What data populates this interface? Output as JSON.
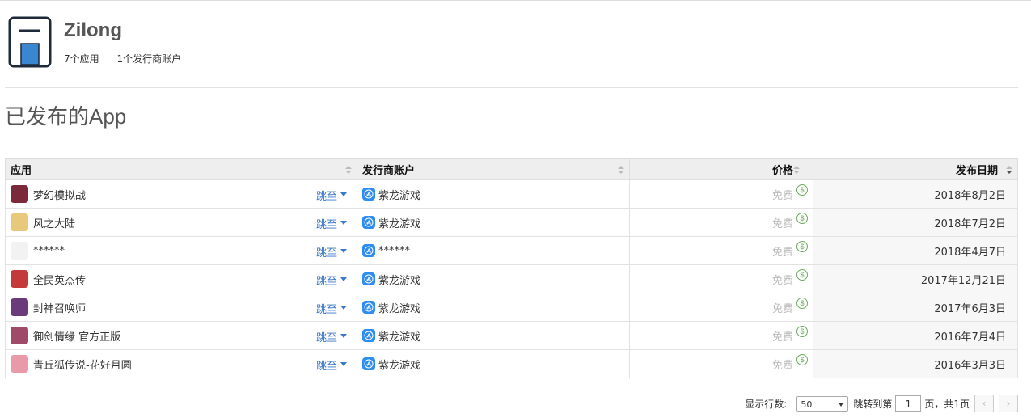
{
  "developer": {
    "name": "Zilong",
    "apps_count": "7个应用",
    "publisher_count": "1个发行商账户"
  },
  "section_title": "已发布的App",
  "table": {
    "headers": {
      "app": "应用",
      "publisher": "发行商账户",
      "price": "价格",
      "release_date": "发布日期"
    },
    "jump_label": "跳至",
    "rows": [
      {
        "app": "梦幻模拟战",
        "publisher": "紫龙游戏",
        "price": "免费",
        "date": "2018年8月2日",
        "icon_color": "#7a2a3a"
      },
      {
        "app": "风之大陆",
        "publisher": "紫龙游戏",
        "price": "免费",
        "date": "2018年7月2日",
        "icon_color": "#e8c87a"
      },
      {
        "app": "******",
        "publisher": "******",
        "price": "免费",
        "date": "2018年4月7日",
        "icon_color": "#f2f2f2"
      },
      {
        "app": "全民英杰传",
        "publisher": "紫龙游戏",
        "price": "免费",
        "date": "2017年12月21日",
        "icon_color": "#c43a3a"
      },
      {
        "app": "封神召唤师",
        "publisher": "紫龙游戏",
        "price": "免费",
        "date": "2017年6月3日",
        "icon_color": "#6a3a7a"
      },
      {
        "app": "御剑情缘 官方正版",
        "publisher": "紫龙游戏",
        "price": "免费",
        "date": "2016年7月4日",
        "icon_color": "#a04a6a"
      },
      {
        "app": "青丘狐传说-花好月圆",
        "publisher": "紫龙游戏",
        "price": "免费",
        "date": "2016年3月3日",
        "icon_color": "#e89aa8"
      }
    ]
  },
  "pagination": {
    "rows_label": "显示行数:",
    "rows_value": "50",
    "jump_label": "跳转到第",
    "page_value": "1",
    "page_suffix": "页，共1页"
  }
}
